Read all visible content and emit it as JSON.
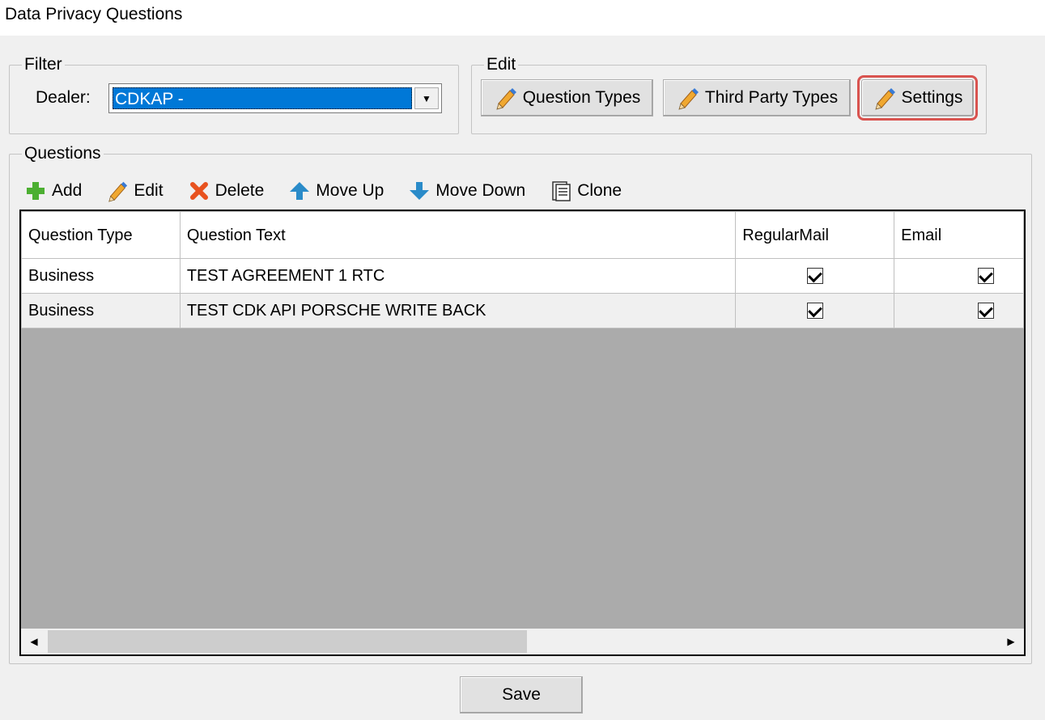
{
  "window": {
    "title": "Data Privacy Questions"
  },
  "filter": {
    "group_label": "Filter",
    "dealer_label": "Dealer:",
    "dealer_value": "CDKAP -"
  },
  "edit": {
    "group_label": "Edit",
    "buttons": [
      {
        "label": "Question Types",
        "icon": "pencil-icon"
      },
      {
        "label": "Third Party Types",
        "icon": "pencil-icon"
      },
      {
        "label": "Settings",
        "icon": "pencil-icon",
        "highlighted": true
      }
    ]
  },
  "questions": {
    "group_label": "Questions",
    "toolbar": [
      {
        "label": "Add",
        "icon": "plus-icon"
      },
      {
        "label": "Edit",
        "icon": "pencil-icon"
      },
      {
        "label": "Delete",
        "icon": "x-icon"
      },
      {
        "label": "Move Up",
        "icon": "arrow-up-icon"
      },
      {
        "label": "Move Down",
        "icon": "arrow-down-icon"
      },
      {
        "label": "Clone",
        "icon": "document-icon"
      }
    ],
    "columns": [
      "Question Type",
      "Question Text",
      "RegularMail",
      "Email"
    ],
    "rows": [
      {
        "type": "Business",
        "text": "TEST AGREEMENT 1 RTC",
        "regular_mail": true,
        "email": true
      },
      {
        "type": "Business",
        "text": "TEST CDK API PORSCHE WRITE BACK",
        "regular_mail": true,
        "email": true
      }
    ]
  },
  "footer": {
    "save_label": "Save"
  },
  "colors": {
    "selection": "#0078d7",
    "highlight": "#d9534f",
    "grid_empty": "#ababab"
  }
}
